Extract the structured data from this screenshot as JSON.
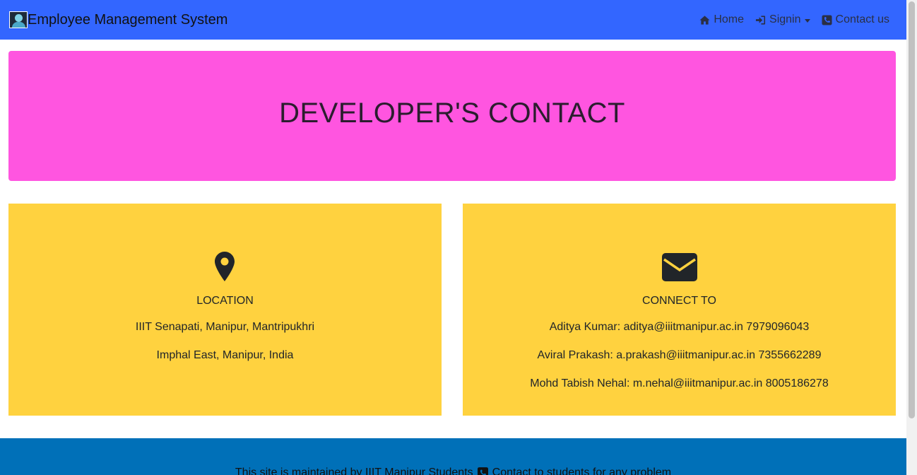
{
  "colors": {
    "nav_bg": "#3366ff",
    "jumbotron_bg": "#ff55e0",
    "card_bg": "#ffd23f",
    "footer_bg": "#0070b8"
  },
  "navbar": {
    "brand": "Employee Management System",
    "brand_icon": "employee-avatar-icon",
    "links": [
      {
        "label": "Home",
        "icon": "home-icon"
      },
      {
        "label": "Signin",
        "icon": "sign-in-icon",
        "has_dropdown": true
      },
      {
        "label": "Contact us",
        "icon": "phone-square-icon"
      }
    ]
  },
  "jumbotron": {
    "title": "DEVELOPER'S CONTACT"
  },
  "location_card": {
    "icon": "map-marker-icon",
    "title": "LOCATION",
    "lines": [
      "IIIT Senapati, Manipur, Mantripukhri",
      "Imphal East, Manipur, India"
    ]
  },
  "connect_card": {
    "icon": "envelope-icon",
    "title": "CONNECT TO",
    "lines": [
      "Aditya Kumar: aditya@iiitmanipur.ac.in 7979096043",
      "Aviral Prakash: a.prakash@iiitmanipur.ac.in 7355662289",
      "Mohd Tabish Nehal: m.nehal@iiitmanipur.ac.in 8005186278"
    ]
  },
  "footer": {
    "maintained_text": "This site is maintained by IIIT Manipur Students",
    "contact_icon": "phone-square-icon",
    "contact_text": "Contact to students for any problem"
  }
}
